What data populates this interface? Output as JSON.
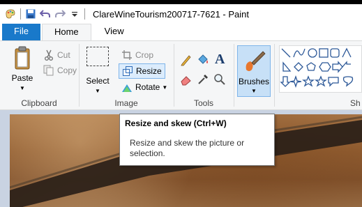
{
  "window": {
    "title": "ClareWineTourism200717-7621 - Paint"
  },
  "quick_access": {
    "icons": [
      "paint-app-icon",
      "save-icon",
      "undo-icon",
      "redo-icon",
      "customize-dropdown-icon"
    ]
  },
  "tabs": [
    {
      "label": "File"
    },
    {
      "label": "Home"
    },
    {
      "label": "View"
    }
  ],
  "ribbon": {
    "clipboard": {
      "label": "Clipboard",
      "paste": "Paste",
      "cut": "Cut",
      "copy": "Copy"
    },
    "image": {
      "label": "Image",
      "select": "Select",
      "crop": "Crop",
      "resize": "Resize",
      "rotate": "Rotate"
    },
    "tools": {
      "label": "Tools"
    },
    "brushes": {
      "label": "Brushes"
    },
    "shapes": {
      "label": "Sh"
    }
  },
  "tooltip": {
    "title": "Resize and skew (Ctrl+W)",
    "description": "Resize and skew the picture or selection."
  },
  "colors": {
    "file_tab": "#1979ca",
    "ribbon_bg": "#f5f6f7",
    "highlight_border": "#7eb4ea",
    "highlight_bg": "#dcecfc"
  }
}
